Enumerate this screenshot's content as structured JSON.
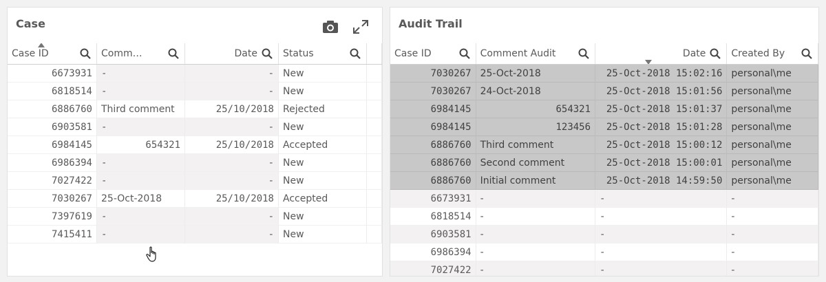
{
  "case_panel": {
    "title": "Case",
    "headers": [
      "Case ID",
      "Comm…",
      "Date",
      "Status"
    ],
    "rows": [
      [
        "6673931",
        "-",
        "-",
        "New"
      ],
      [
        "6818514",
        "-",
        "-",
        "New"
      ],
      [
        "6886760",
        "Third comment",
        "25/10/2018",
        "Rejected"
      ],
      [
        "6903581",
        "-",
        "-",
        "New"
      ],
      [
        "6984145",
        "654321",
        "25/10/2018",
        "Accepted"
      ],
      [
        "6986394",
        "-",
        "-",
        "New"
      ],
      [
        "7027422",
        "-",
        "-",
        "New"
      ],
      [
        "7030267",
        "25-Oct-2018",
        "25/10/2018",
        "Accepted"
      ],
      [
        "7397619",
        "-",
        "-",
        "New"
      ],
      [
        "7415411",
        "-",
        "-",
        "New"
      ]
    ]
  },
  "audit_panel": {
    "title": "Audit Trail",
    "headers": [
      "Case ID",
      "Comment Audit",
      "Date",
      "Created By"
    ],
    "rows": [
      [
        "7030267",
        "25-Oct-2018",
        "25-Oct-2018 15:02:16",
        "personal\\me"
      ],
      [
        "7030267",
        "24-Oct-2018",
        "25-Oct-2018 15:01:56",
        "personal\\me"
      ],
      [
        "6984145",
        "654321",
        "25-Oct-2018 15:01:37",
        "personal\\me"
      ],
      [
        "6984145",
        "123456",
        "25-Oct-2018 15:01:28",
        "personal\\me"
      ],
      [
        "6886760",
        "Third comment",
        "25-Oct-2018 15:00:12",
        "personal\\me"
      ],
      [
        "6886760",
        "Second comment",
        "25-Oct-2018 15:00:01",
        "personal\\me"
      ],
      [
        "6886760",
        "Initial comment",
        "25-Oct-2018 14:59:50",
        "personal\\me"
      ],
      [
        "6673931",
        "-",
        "-",
        "-"
      ],
      [
        "6818514",
        "-",
        "-",
        "-"
      ],
      [
        "6903581",
        "-",
        "-",
        "-"
      ],
      [
        "6986394",
        "-",
        "-",
        "-"
      ],
      [
        "7027422",
        "-",
        "-",
        "-"
      ]
    ],
    "selected_row_count": 7
  },
  "icons": {
    "camera": "camera-icon",
    "expand": "expand-icon",
    "search": "search-icon",
    "cursor": "hand-cursor-icon"
  },
  "colors": {
    "selected_row": "#c8c8c8",
    "alternate_row": "#f4f1f2",
    "text": "#595959"
  }
}
